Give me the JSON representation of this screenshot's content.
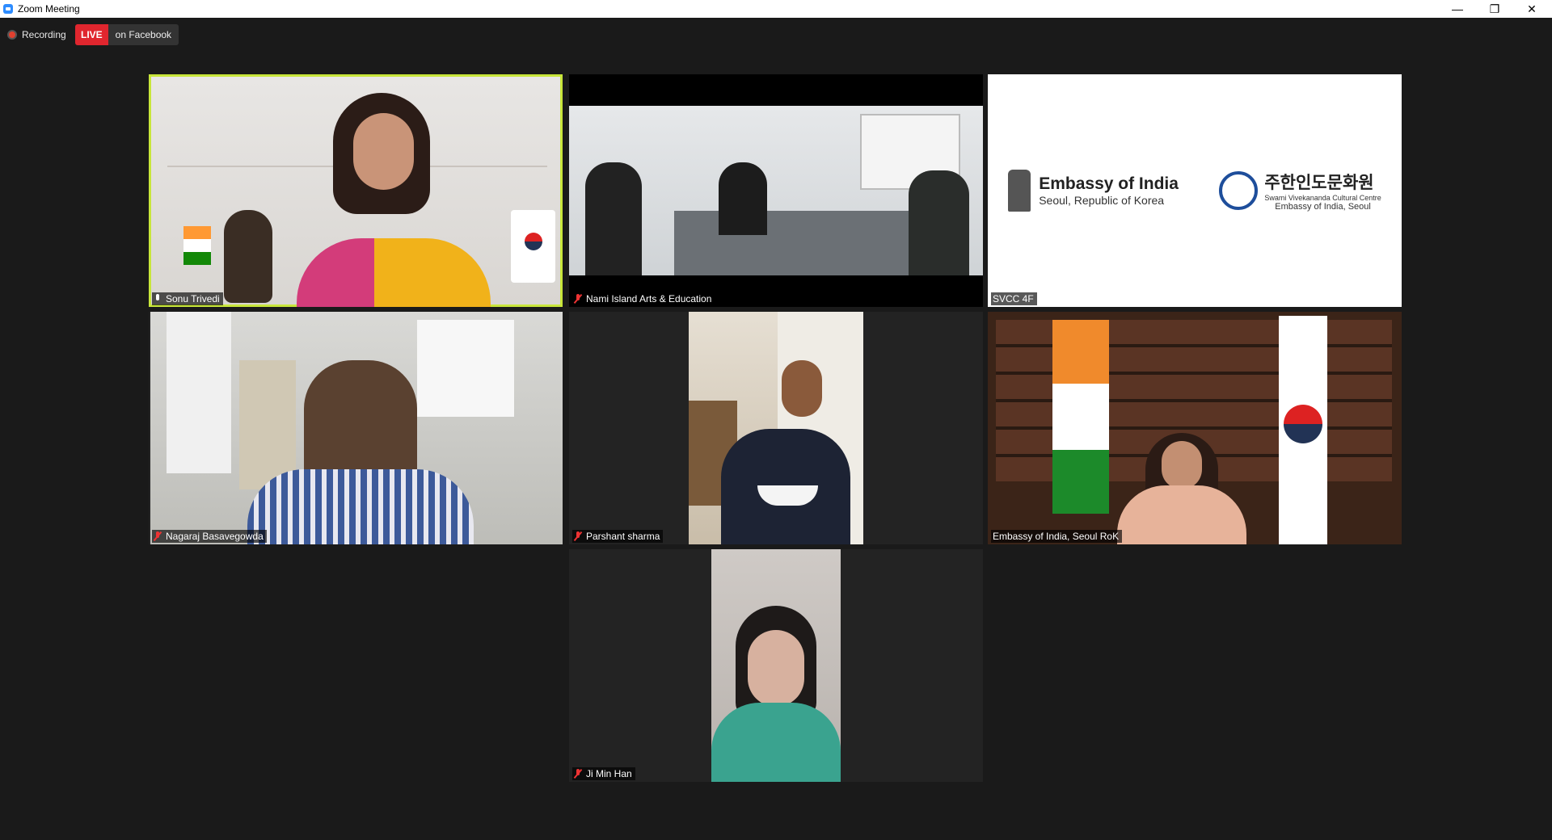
{
  "window": {
    "title": "Zoom Meeting",
    "minimize_label": "—",
    "maximize_label": "❐",
    "close_label": "✕"
  },
  "status": {
    "recording_label": "Recording",
    "live_badge": "LIVE",
    "live_platform": "on Facebook"
  },
  "participants": [
    {
      "name": "Sonu Trivedi",
      "muted": false,
      "speaking": true
    },
    {
      "name": "Nami Island Arts & Education",
      "muted": true,
      "speaking": false
    },
    {
      "name": "SVCC 4F",
      "muted": false,
      "speaking": false
    },
    {
      "name": "Nagaraj Basavegowda",
      "muted": true,
      "speaking": false
    },
    {
      "name": "Parshant sharma",
      "muted": true,
      "speaking": false
    },
    {
      "name": "Embassy of India, Seoul RoK",
      "muted": false,
      "speaking": false
    },
    {
      "name": "Ji Min Han",
      "muted": true,
      "speaking": false
    }
  ],
  "embassy_logo": {
    "en_title": "Embassy of India",
    "en_subtitle": "Seoul, Republic of Korea",
    "kr_title": "주한인도문화원",
    "kr_sub1": "Swami Vivekananda Cultural Centre",
    "kr_sub2": "Embassy of India, Seoul"
  },
  "colors": {
    "background": "#1a1a1a",
    "speaker_border": "#c8e63a",
    "live_red": "#e0262e"
  }
}
